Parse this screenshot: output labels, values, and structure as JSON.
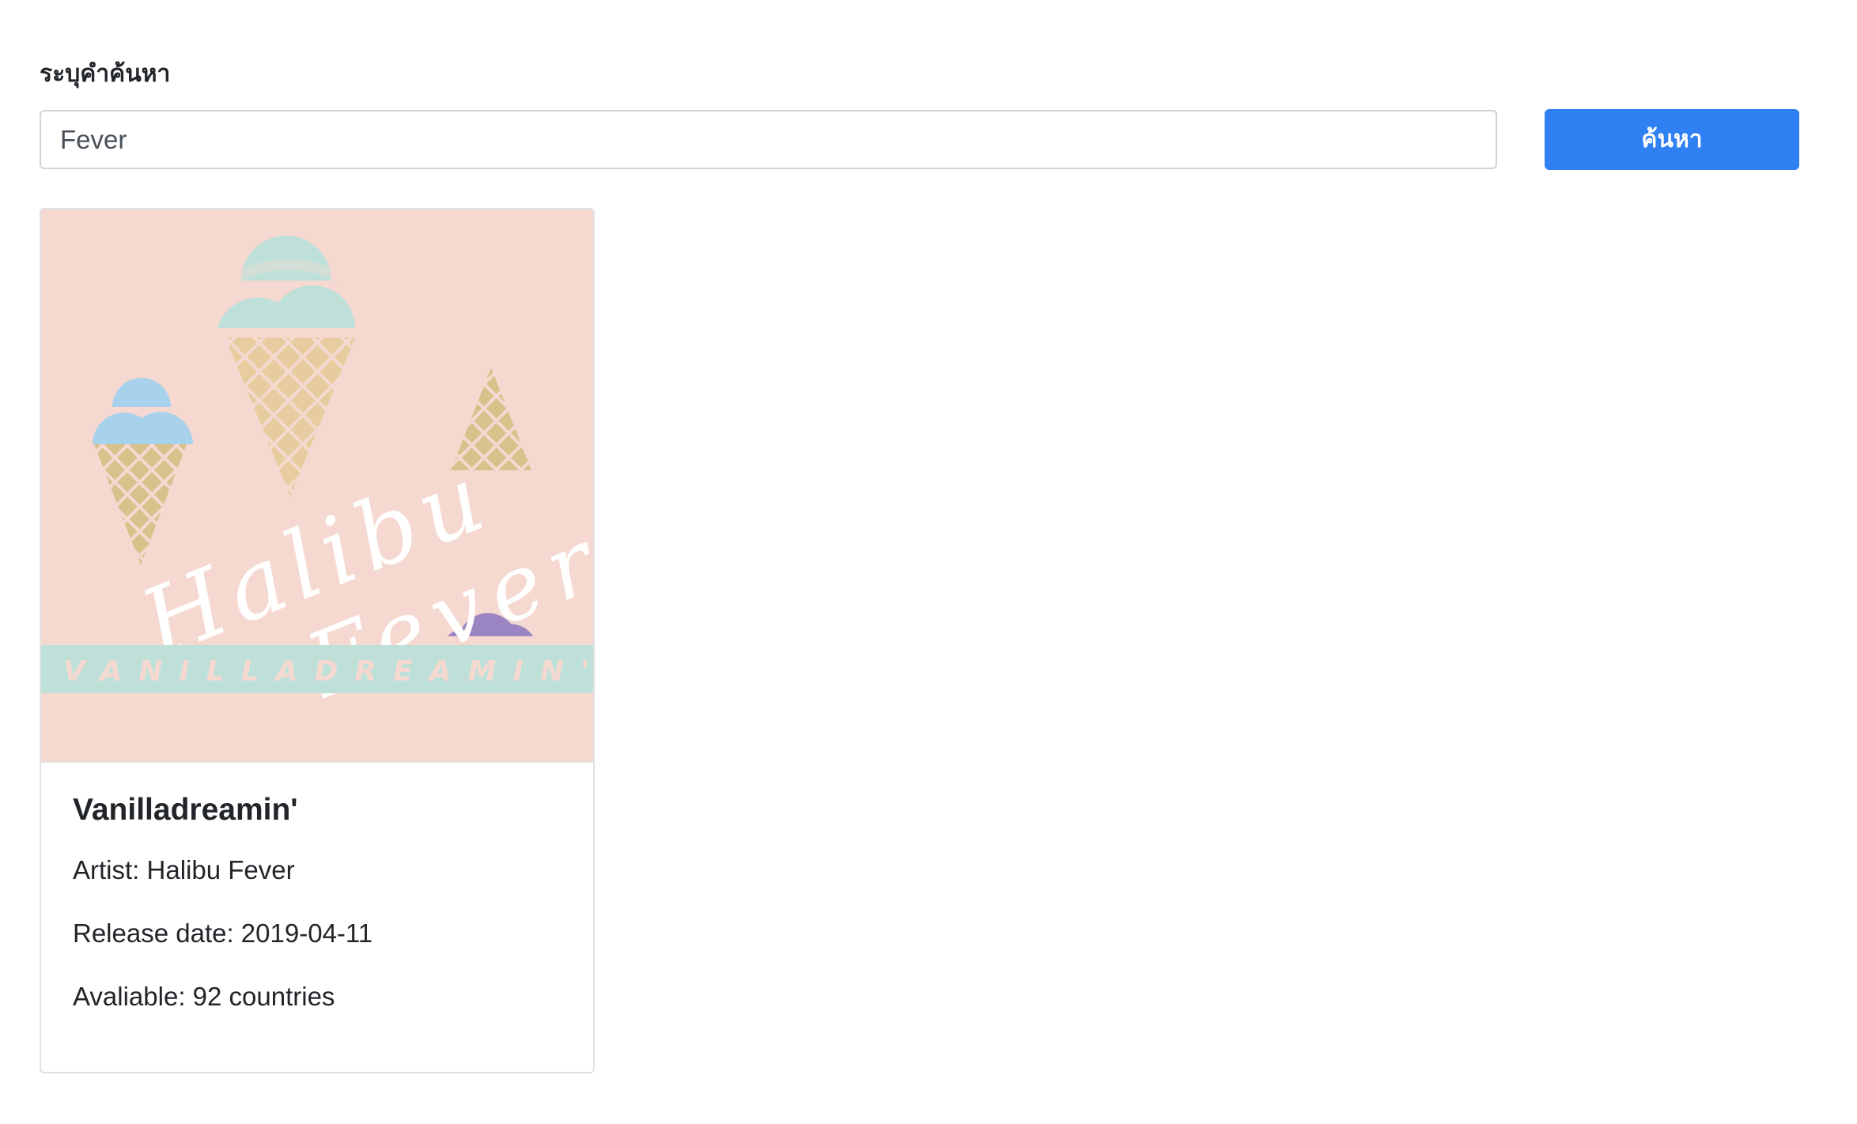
{
  "search": {
    "label": "ระบุคำค้นหา",
    "value": "Fever",
    "button_label": "ค้นหา"
  },
  "results": [
    {
      "cover": {
        "script_line_1": "Halibu",
        "script_line_2": "Fever",
        "banner_text": "VANILLADREAMIN'"
      },
      "title": "Vanilladreamin'",
      "artist_line": "Artist: Halibu Fever",
      "release_line": "Release date: 2019-04-11",
      "available_line": "Avaliable: 92 countries"
    }
  ],
  "colors": {
    "button": "#2f80f3",
    "cover_background": "#f5d9d1",
    "cover_banner": "#bfe0d9",
    "mint_scoop": "#bfe0d9",
    "blue_scoop": "#a8d2eb",
    "purple_scoop": "#9b85c2",
    "cone": "#e6cc9e"
  }
}
